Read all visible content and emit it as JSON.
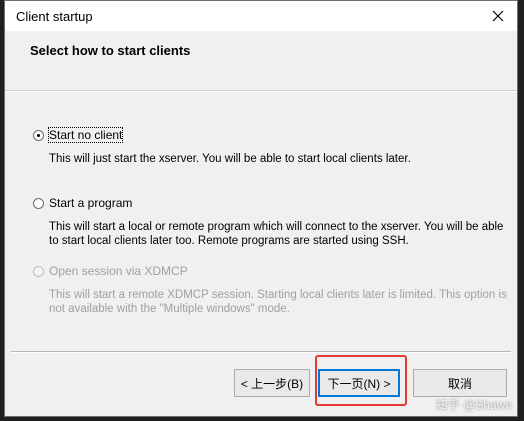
{
  "window": {
    "title": "Client startup"
  },
  "header": {
    "title": "Select how to start clients"
  },
  "options": [
    {
      "label": "Start no client",
      "description": [
        "This will just start the xserver. You will be able to start local clients later."
      ],
      "checked": true,
      "enabled": true
    },
    {
      "label": "Start a program",
      "description": [
        "This will start a local or remote program which will connect to the xserver. You will be able",
        "to start local clients later too. Remote programs are started using SSH."
      ],
      "checked": false,
      "enabled": true
    },
    {
      "label": "Open session via XDMCP",
      "description": [
        "This will start a remote XDMCP session. Starting local clients later is limited. This option is",
        "not available with the \"Multiple windows\" mode."
      ],
      "checked": false,
      "enabled": false
    }
  ],
  "buttons": {
    "back": "< 上一步(B)",
    "next": "下一页(N) >",
    "cancel": "取消"
  },
  "watermark": "知乎 @Shawn",
  "colors": {
    "highlight": "#e53935",
    "default_button": "#0078d7"
  }
}
